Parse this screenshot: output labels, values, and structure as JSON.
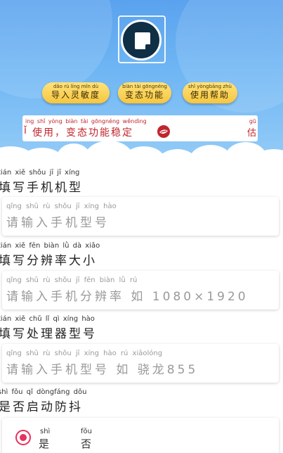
{
  "pills": [
    {
      "pinyin": "dǎo rù líng mǐn dù",
      "label": "导入灵敏度"
    },
    {
      "pinyin": "biàn tài gōngnéng",
      "label": "变态功能"
    },
    {
      "pinyin": "shǐ yòngbāng zhù",
      "label": "使用帮助"
    }
  ],
  "notice": {
    "pinyin": "ing shǐ yòng     biàn tài gōngnéng wěndìng",
    "text": "使用，变态功能稳定",
    "left_glyph": "ǐ",
    "edge_pinyin": "gū",
    "edge_text": "估"
  },
  "sections": {
    "model": {
      "title_pinyin": "tián xiě shǒu   jī    jī  xíng",
      "title": "填写手机机型",
      "placeholder_pinyin": "qǐng shū   rù  shǒu   jī  xíng hào",
      "placeholder": "请输入手机型号"
    },
    "resolution": {
      "title_pinyin": "tián xiě fēn biàn lǜ   dà  xiǎo",
      "title": "填写分辨率大小",
      "placeholder_pinyin": "qǐng shū   rù  shǒu   jī  fēn biàn  lǜ     rú",
      "placeholder": "请输入手机分辨率 如 1080×1920"
    },
    "processor": {
      "title_pinyin": "tián xiě chǔ   lǐ    qì  xíng hào",
      "title": "填写处理器型号",
      "placeholder_pinyin": "qǐng shū   rù  shǒu   jī  xíng hào    rú   xiāolóng",
      "placeholder": "请输入手机型号 如 骁龙855"
    },
    "shake": {
      "title_pinyin": "shì fǒu  qǐ  dòngfáng dǒu",
      "title": "是否启动防抖",
      "yes_pinyin": "shì",
      "yes": "是",
      "no_pinyin": "fǒu",
      "no": "否"
    }
  },
  "colors": {
    "sky_top": "#5aa2ee",
    "pill_gold": "#f6c640",
    "notice_red": "#c0262e",
    "radio_accent": "#e8315c"
  }
}
